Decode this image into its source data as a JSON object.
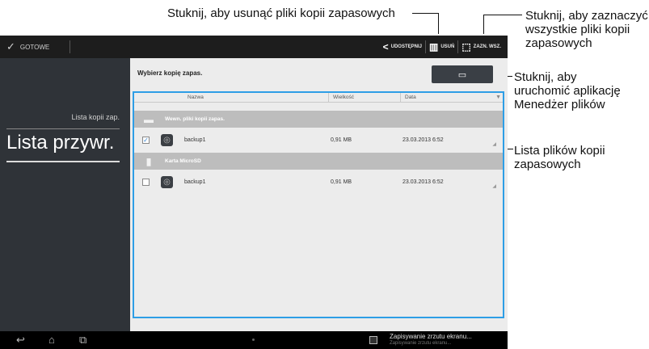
{
  "callouts": {
    "delete": "Stuknij, aby usunąć pliki kopii zapasowych",
    "select_all": [
      "Stuknij, aby zaznaczyć",
      "wszystkie pliki kopii",
      "zapasowych"
    ],
    "file_manager": [
      "Stuknij, aby",
      "uruchomić aplikację",
      "Menedżer plików"
    ],
    "list": [
      "Lista plików kopii",
      "zapasowych"
    ]
  },
  "actionbar": {
    "done_label": "GOTOWE",
    "share_label": "UDOSTĘPNIJ",
    "delete_label": "USUŃ",
    "select_all_label": "ZAZN. WSZ."
  },
  "sidebar": {
    "backup_list": "Lista kopii zap.",
    "restore_list": "Lista przywr."
  },
  "content": {
    "title": "Wybierz kopię zapas.",
    "columns": [
      "Nazwa",
      "Wielkość",
      "Data"
    ],
    "groups": [
      {
        "label": "Wewn. pliki kopii zapas.",
        "rows": [
          {
            "name": "backup1",
            "size": "0,91 MB",
            "date": "23.03.2013 6:52",
            "checked": true
          }
        ]
      },
      {
        "label": "Karta MicroSD",
        "rows": [
          {
            "name": "backup1",
            "size": "0,91 MB",
            "date": "23.03.2013 6:52",
            "checked": false
          }
        ]
      }
    ]
  },
  "notification": {
    "title": "Zapisywanie zrzutu ekranu...",
    "subtitle": "Zapisywanie zrzutu ekranu..."
  },
  "colors": {
    "selection_border": "#2e9ee6",
    "sidebar_bg": "#2f3338",
    "actionbar_bg": "#1d1d1d"
  },
  "icons": [
    "check-icon",
    "share-icon",
    "trash-icon",
    "select-all-icon",
    "folder-icon",
    "sd-card-icon",
    "app-icon",
    "back-icon",
    "home-icon",
    "recent-apps-icon",
    "screenshot-icon"
  ]
}
